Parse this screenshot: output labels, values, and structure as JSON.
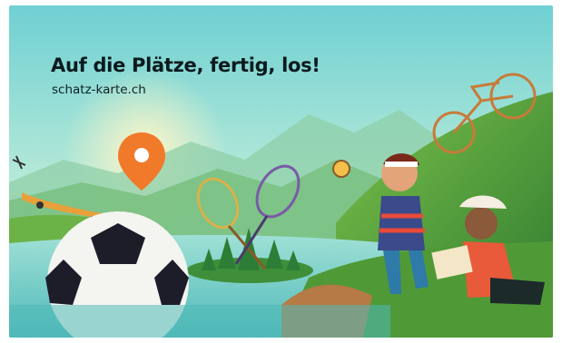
{
  "banner": {
    "headline": "Auf die Plätze, fertig, los!",
    "website": "schatz-karte.ch"
  },
  "colors": {
    "sky_top": "#6fd0d3",
    "sky_bottom": "#cdeee0",
    "sun_glow": "#fff3c0",
    "hill_green": "#5aa83c",
    "water": "#7fd2cf",
    "pin_orange": "#f07a2a",
    "headline_text": "#0b1a1d"
  },
  "icons": {
    "location_pin": "map-pin-icon"
  }
}
